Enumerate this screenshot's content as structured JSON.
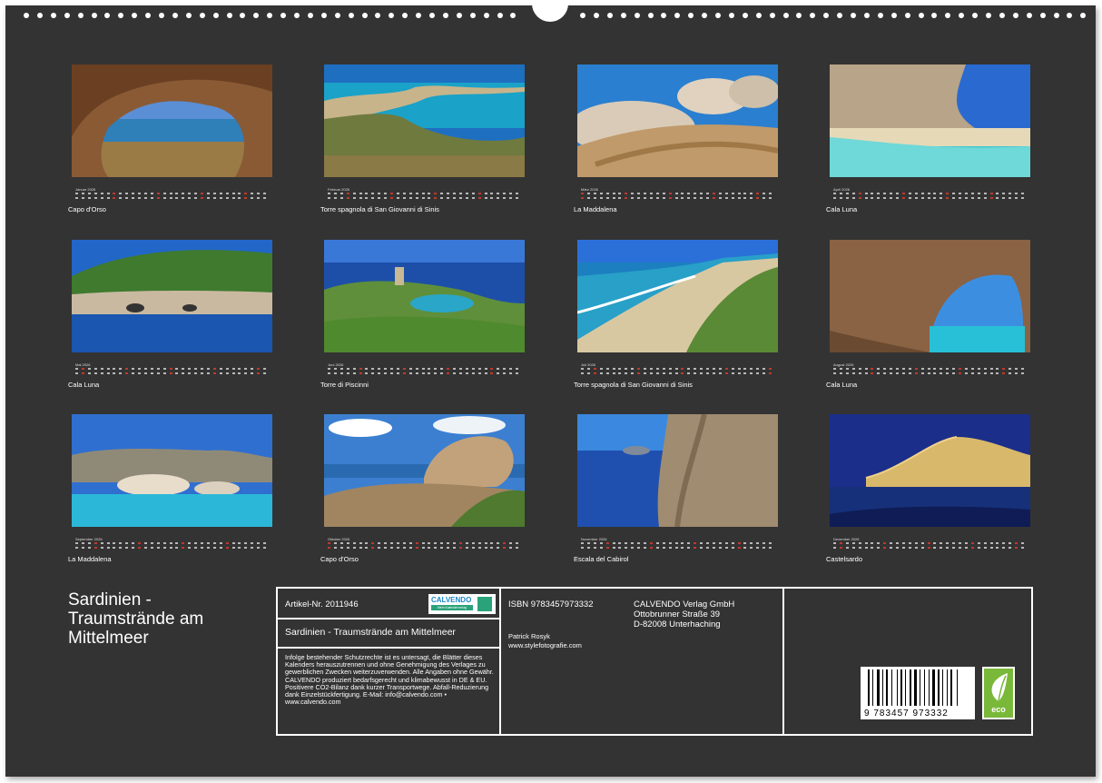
{
  "months": [
    {
      "label": "Januar 2026",
      "caption": "Capo d'Orso",
      "image": "granite-arch-sea-view"
    },
    {
      "label": "Februar 2026",
      "caption": "Torre spagnola di San Giovanni di Sinis",
      "image": "peninsula-turquoise-bay"
    },
    {
      "label": "März 2026",
      "caption": "La Maddalena",
      "image": "granite-boulders-coast"
    },
    {
      "label": "April 2026",
      "caption": "Cala Luna",
      "image": "cliff-beach-clear-water"
    },
    {
      "label": "Mai 2026",
      "caption": "Cala Luna",
      "image": "green-cliffs-caves"
    },
    {
      "label": "Juni 2026",
      "caption": "Torre di Piscinni",
      "image": "tower-on-headland"
    },
    {
      "label": "Juli 2026",
      "caption": "Torre spagnola di San Giovanni di Sinis",
      "image": "beach-waves-tower"
    },
    {
      "label": "August 2026",
      "caption": "Cala Luna",
      "image": "sea-cave-view"
    },
    {
      "label": "September 2026",
      "caption": "La Maddalena",
      "image": "island-rocks-turquoise"
    },
    {
      "label": "Oktober 2026",
      "caption": "Capo d'Orso",
      "image": "bear-rock-clouds"
    },
    {
      "label": "November 2026",
      "caption": "Escala del Cabirol",
      "image": "high-cliff-blue-sea"
    },
    {
      "label": "Dezember 2026",
      "caption": "Castelsardo",
      "image": "town-night-lights"
    }
  ],
  "title": "Sardinien - Traumstrände am Mittelmeer",
  "info": {
    "article": "Artikel-Nr. 2011946",
    "logo_text": "CALVENDO",
    "logo_sub": "Mein Kalenderverlag",
    "product_title": "Sardinien - Traumstrände am Mittelmeer",
    "legal_text": "Infolge bestehender Schutzrechte ist es untersagt, die Blätter dieses Kalenders herauszutrennen und ohne Genehmigung des Verlages zu gewerblichen Zwecken weiterzuverwenden. Alle Angaben ohne Gewähr. CALVENDO produziert bedarfsgerecht und klimabewusst in DE & EU. Positivere CO2-Bilanz dank kurzer Transportwege. Abfall-Reduzierung dank Einzelstückfertigung. E-Mail: info@calvendo.com • www.calvendo.com",
    "isbn": "ISBN 9783457973332",
    "author": "Patrick Rosyk",
    "website": "www.stylefotografie.com",
    "publisher_name": "CALVENDO Verlag GmbH",
    "publisher_street": "Ottobrunner Straße 39",
    "publisher_city": "D-82008 Unterhaching",
    "barcode_number": "9 783457 973332",
    "eco_label": "eco"
  },
  "colors": {
    "background": "#333333",
    "text": "#ffffff",
    "eco_green": "#7ab83a",
    "calvendo_blue": "#1e88c8"
  }
}
